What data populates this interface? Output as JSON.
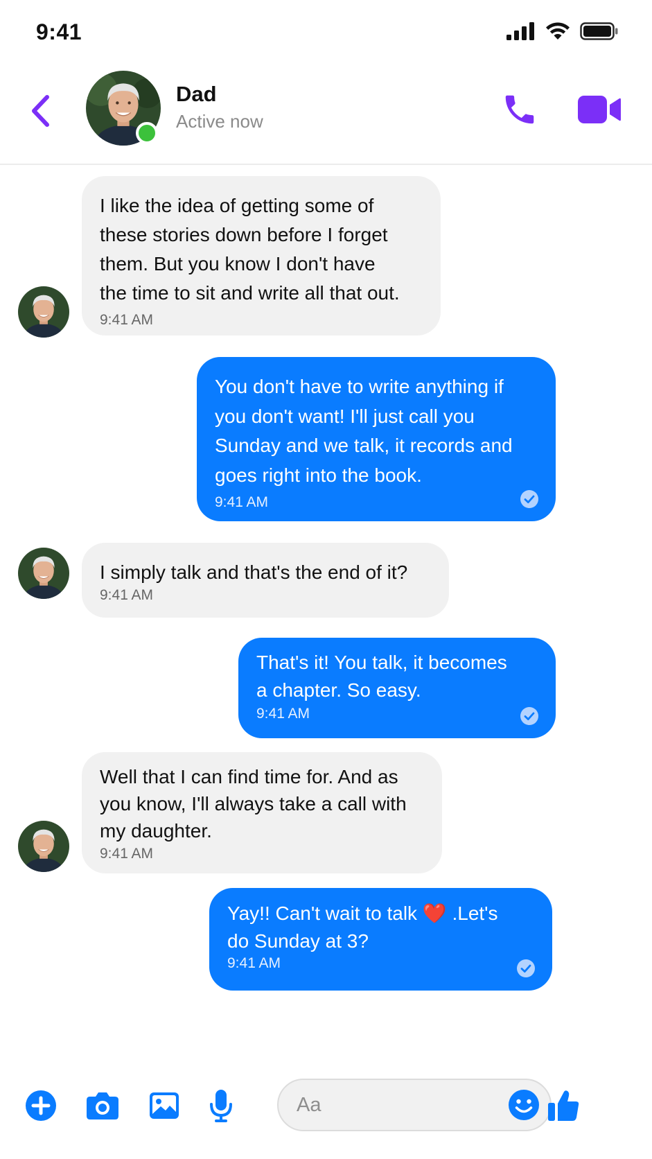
{
  "status_bar": {
    "time": "9:41"
  },
  "header": {
    "contact_name": "Dad",
    "contact_status": "Active now"
  },
  "colors": {
    "accent": "#7b2ff7",
    "outgoing_bubble": "#0a7cff",
    "incoming_bubble": "#f1f1f1",
    "online": "#3cc13b",
    "toolbar_icon": "#0a7cff"
  },
  "messages": [
    {
      "direction": "incoming",
      "text": "I like the idea of getting some of\nthese stories down before I forget\nthem. But you know I don't have\nthe time to sit and write all that out.",
      "time": "9:41 AM"
    },
    {
      "direction": "outgoing",
      "text": "You don't have to write anything if\nyou don't want! I'll just call you\nSunday and we talk, it records and\ngoes right into the book.",
      "time": "9:41 AM",
      "status_icon": "read-check-icon"
    },
    {
      "direction": "incoming",
      "text": "I simply talk and that's the end of it?",
      "time": "9:41 AM"
    },
    {
      "direction": "outgoing",
      "text": "That's it! You talk, it becomes\na chapter. So easy.",
      "time": "9:41 AM",
      "status_icon": "read-check-icon"
    },
    {
      "direction": "incoming",
      "text": "Well that I can find time for. And as\nyou know, I'll always take a call with\nmy daughter.",
      "time": "9:41 AM"
    },
    {
      "direction": "outgoing",
      "text": "Yay!! Can't wait to talk ❤️ .Let's\ndo Sunday at 3?",
      "time": "9:41 AM",
      "status_icon": "read-check-icon"
    }
  ],
  "composer": {
    "placeholder": "Aa",
    "value": "",
    "icons": [
      "plus-icon",
      "camera-icon",
      "image-icon",
      "microphone-icon",
      "emoji-icon",
      "thumbs-up-icon"
    ]
  }
}
